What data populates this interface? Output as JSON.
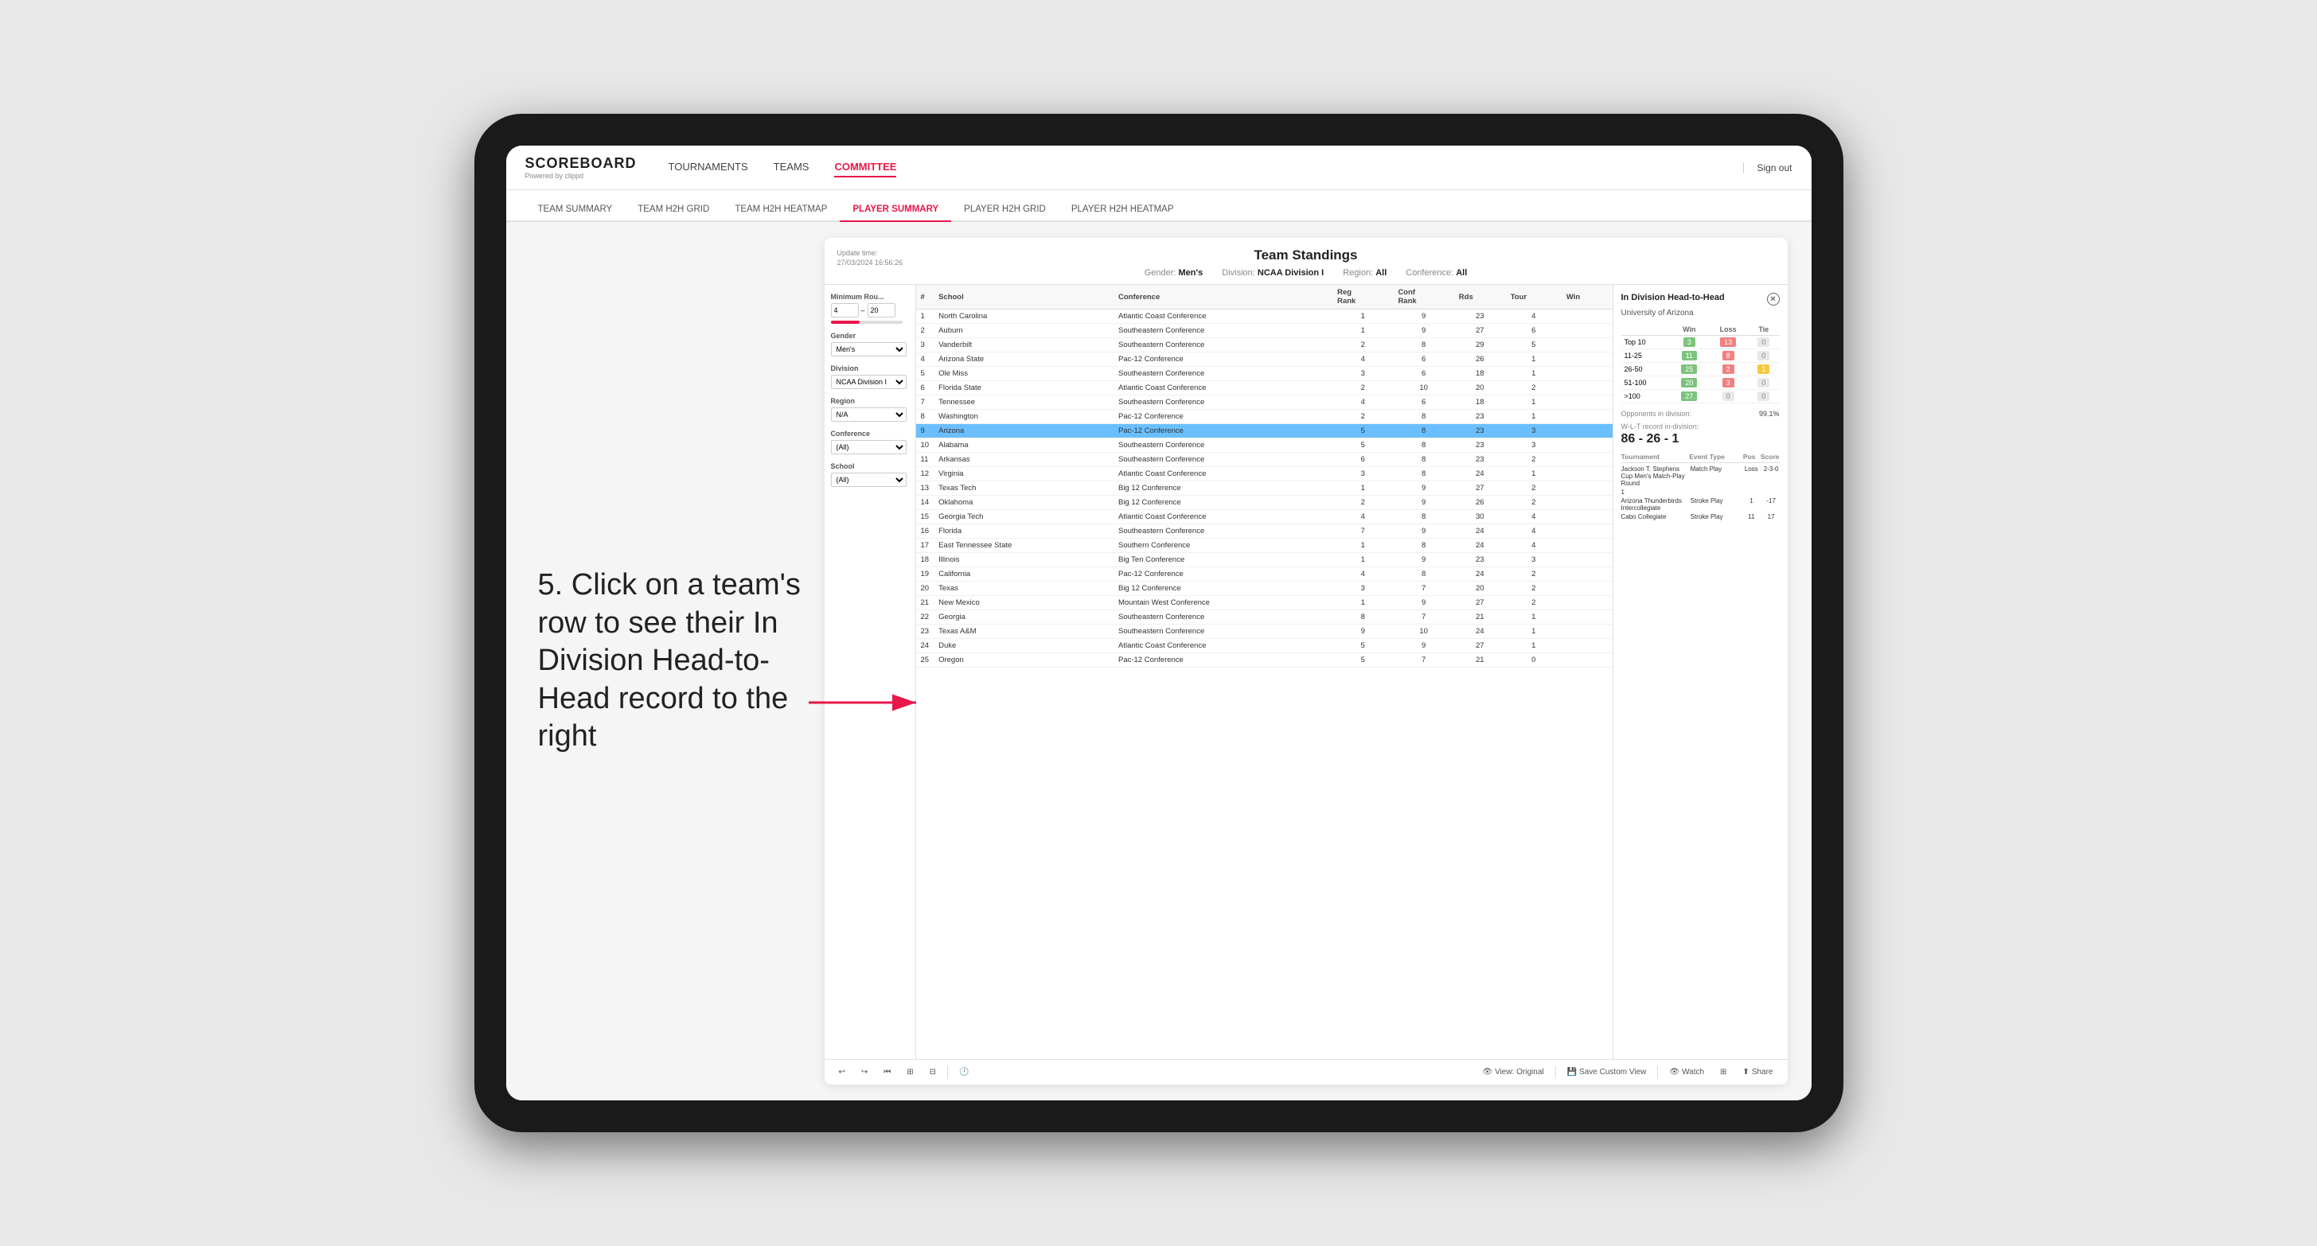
{
  "app": {
    "logo": "SCOREBOARD",
    "logo_sub": "Powered by clippd",
    "sign_out": "Sign out"
  },
  "nav": {
    "links": [
      "TOURNAMENTS",
      "TEAMS",
      "COMMITTEE"
    ],
    "active": "COMMITTEE"
  },
  "sub_nav": {
    "links": [
      "TEAM SUMMARY",
      "TEAM H2H GRID",
      "TEAM H2H HEATMAP",
      "PLAYER SUMMARY",
      "PLAYER H2H GRID",
      "PLAYER H2H HEATMAP"
    ],
    "active": "PLAYER SUMMARY"
  },
  "annotation": {
    "text": "5. Click on a team's row to see their In Division Head-to-Head record to the right"
  },
  "panel": {
    "update_time": "Update time:\n27/03/2024 16:56:26",
    "title": "Team Standings",
    "filters": {
      "gender": "Men's",
      "division": "NCAA Division I",
      "region": "All",
      "conference": "All"
    },
    "min_rounds_label": "Minimum Rou...",
    "min_rounds_value": "4",
    "min_rounds_max": "20",
    "gender_label": "Gender",
    "gender_value": "Men's",
    "division_label": "Division",
    "division_value": "NCAA Division I",
    "region_label": "Region",
    "region_value": "N/A",
    "conference_label": "Conference",
    "conference_value": "(All)",
    "school_label": "School",
    "school_value": "(All)"
  },
  "table": {
    "headers": [
      "#",
      "School",
      "Conference",
      "Reg Rank",
      "Conf Rank",
      "Rds",
      "Tour",
      "Win"
    ],
    "rows": [
      {
        "rank": 1,
        "school": "North Carolina",
        "conference": "Atlantic Coast Conference",
        "reg_rank": 1,
        "conf_rank": 9,
        "rds": 23,
        "tour": 4,
        "highlighted": false
      },
      {
        "rank": 2,
        "school": "Auburn",
        "conference": "Southeastern Conference",
        "reg_rank": 1,
        "conf_rank": 9,
        "rds": 27,
        "tour": 6,
        "highlighted": false
      },
      {
        "rank": 3,
        "school": "Vanderbilt",
        "conference": "Southeastern Conference",
        "reg_rank": 2,
        "conf_rank": 8,
        "rds": 29,
        "tour": 5,
        "highlighted": false
      },
      {
        "rank": 4,
        "school": "Arizona State",
        "conference": "Pac-12 Conference",
        "reg_rank": 4,
        "conf_rank": 6,
        "rds": 26,
        "tour": 1,
        "highlighted": false
      },
      {
        "rank": 5,
        "school": "Ole Miss",
        "conference": "Southeastern Conference",
        "reg_rank": 3,
        "conf_rank": 6,
        "rds": 18,
        "tour": 1,
        "highlighted": false
      },
      {
        "rank": 6,
        "school": "Florida State",
        "conference": "Atlantic Coast Conference",
        "reg_rank": 2,
        "conf_rank": 10,
        "rds": 20,
        "tour": 2,
        "highlighted": false
      },
      {
        "rank": 7,
        "school": "Tennessee",
        "conference": "Southeastern Conference",
        "reg_rank": 4,
        "conf_rank": 6,
        "rds": 18,
        "tour": 1,
        "highlighted": false
      },
      {
        "rank": 8,
        "school": "Washington",
        "conference": "Pac-12 Conference",
        "reg_rank": 2,
        "conf_rank": 8,
        "rds": 23,
        "tour": 1,
        "highlighted": false
      },
      {
        "rank": 9,
        "school": "Arizona",
        "conference": "Pac-12 Conference",
        "reg_rank": 5,
        "conf_rank": 8,
        "rds": 23,
        "tour": 3,
        "highlighted": true
      },
      {
        "rank": 10,
        "school": "Alabama",
        "conference": "Southeastern Conference",
        "reg_rank": 5,
        "conf_rank": 8,
        "rds": 23,
        "tour": 3,
        "highlighted": false
      },
      {
        "rank": 11,
        "school": "Arkansas",
        "conference": "Southeastern Conference",
        "reg_rank": 6,
        "conf_rank": 8,
        "rds": 23,
        "tour": 2,
        "highlighted": false
      },
      {
        "rank": 12,
        "school": "Virginia",
        "conference": "Atlantic Coast Conference",
        "reg_rank": 3,
        "conf_rank": 8,
        "rds": 24,
        "tour": 1,
        "highlighted": false
      },
      {
        "rank": 13,
        "school": "Texas Tech",
        "conference": "Big 12 Conference",
        "reg_rank": 1,
        "conf_rank": 9,
        "rds": 27,
        "tour": 2,
        "highlighted": false
      },
      {
        "rank": 14,
        "school": "Oklahoma",
        "conference": "Big 12 Conference",
        "reg_rank": 2,
        "conf_rank": 9,
        "rds": 26,
        "tour": 2,
        "highlighted": false
      },
      {
        "rank": 15,
        "school": "Georgia Tech",
        "conference": "Atlantic Coast Conference",
        "reg_rank": 4,
        "conf_rank": 8,
        "rds": 30,
        "tour": 4,
        "highlighted": false
      },
      {
        "rank": 16,
        "school": "Florida",
        "conference": "Southeastern Conference",
        "reg_rank": 7,
        "conf_rank": 9,
        "rds": 24,
        "tour": 4,
        "highlighted": false
      },
      {
        "rank": 17,
        "school": "East Tennessee State",
        "conference": "Southern Conference",
        "reg_rank": 1,
        "conf_rank": 8,
        "rds": 24,
        "tour": 4,
        "highlighted": false
      },
      {
        "rank": 18,
        "school": "Illinois",
        "conference": "Big Ten Conference",
        "reg_rank": 1,
        "conf_rank": 9,
        "rds": 23,
        "tour": 3,
        "highlighted": false
      },
      {
        "rank": 19,
        "school": "California",
        "conference": "Pac-12 Conference",
        "reg_rank": 4,
        "conf_rank": 8,
        "rds": 24,
        "tour": 2,
        "highlighted": false
      },
      {
        "rank": 20,
        "school": "Texas",
        "conference": "Big 12 Conference",
        "reg_rank": 3,
        "conf_rank": 7,
        "rds": 20,
        "tour": 2,
        "highlighted": false
      },
      {
        "rank": 21,
        "school": "New Mexico",
        "conference": "Mountain West Conference",
        "reg_rank": 1,
        "conf_rank": 9,
        "rds": 27,
        "tour": 2,
        "highlighted": false
      },
      {
        "rank": 22,
        "school": "Georgia",
        "conference": "Southeastern Conference",
        "reg_rank": 8,
        "conf_rank": 7,
        "rds": 21,
        "tour": 1,
        "highlighted": false
      },
      {
        "rank": 23,
        "school": "Texas A&M",
        "conference": "Southeastern Conference",
        "reg_rank": 9,
        "conf_rank": 10,
        "rds": 24,
        "tour": 1,
        "highlighted": false
      },
      {
        "rank": 24,
        "school": "Duke",
        "conference": "Atlantic Coast Conference",
        "reg_rank": 5,
        "conf_rank": 9,
        "rds": 27,
        "tour": 1,
        "highlighted": false
      },
      {
        "rank": 25,
        "school": "Oregon",
        "conference": "Pac-12 Conference",
        "reg_rank": 5,
        "conf_rank": 7,
        "rds": 21,
        "tour": 0,
        "highlighted": false
      }
    ]
  },
  "h2h": {
    "title": "In Division Head-to-Head",
    "school": "University of Arizona",
    "categories": [
      "Top 10",
      "11-25",
      "26-50",
      "51-100",
      ">100"
    ],
    "wins": [
      3,
      11,
      25,
      20,
      27
    ],
    "losses": [
      13,
      8,
      2,
      3,
      0
    ],
    "ties": [
      0,
      0,
      1,
      0,
      0
    ],
    "opponents_label": "Opponents in division:",
    "opponents_value": "99.1%",
    "wlt_label": "W-L-T record in-division:",
    "wlt_value": "86 - 26 - 1",
    "tournament_cols": [
      "Tournament",
      "Event Type",
      "Pos",
      "Score"
    ],
    "tournaments": [
      {
        "name": "Jackson T. Stephens Cup Men's Match-Play Round",
        "type": "Match Play",
        "result": "Loss",
        "score": "2-3-0"
      },
      {
        "name": "1",
        "type": "",
        "result": "",
        "score": ""
      },
      {
        "name": "Arizona Thunderbirds Intercollegiate",
        "type": "Stroke Play",
        "result": "1",
        "score": "-17"
      },
      {
        "name": "Cabo Collegiate",
        "type": "Stroke Play",
        "result": "11",
        "score": "17"
      }
    ]
  },
  "toolbar": {
    "undo": "↩",
    "redo": "↪",
    "copy": "⊞",
    "view_original": "View: Original",
    "save_custom": "Save Custom View",
    "watch": "Watch",
    "share": "Share"
  }
}
